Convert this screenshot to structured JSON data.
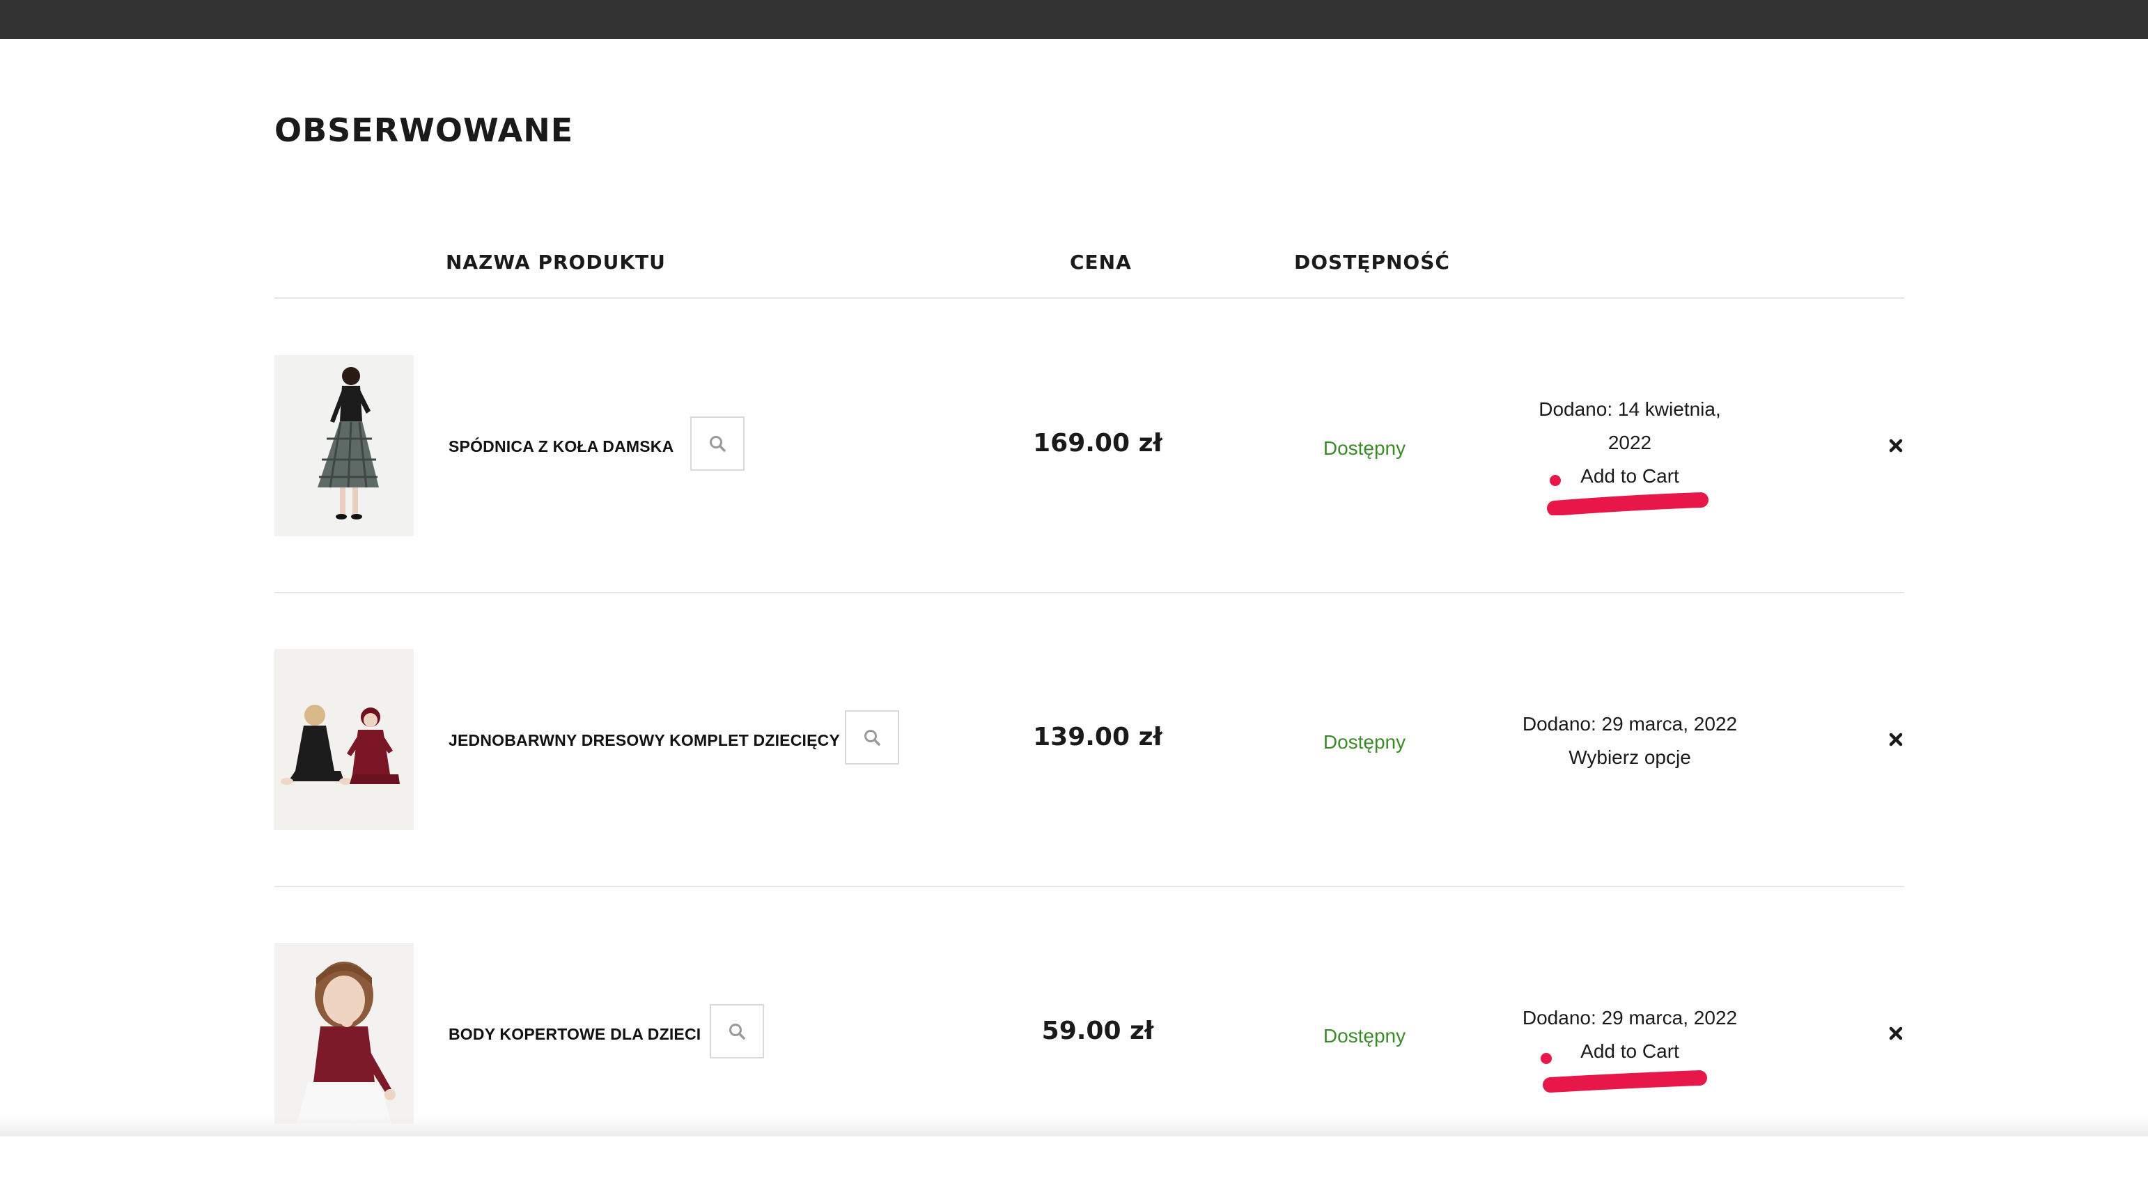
{
  "page": {
    "title": "OBSERWOWANE"
  },
  "table": {
    "headers": {
      "name": "NAZWA PRODUKTU",
      "price": "CENA",
      "availability": "DOSTĘPNOŚĆ"
    },
    "rows": [
      {
        "name": "SPÓDNICA Z KOŁA DAMSKA",
        "price": "169.00 zł",
        "availability": "Dostępny",
        "added_line1": "Dodano: 14 kwietnia,",
        "added_line2": "2022",
        "action": "Add to Cart"
      },
      {
        "name": "JEDNOBARWNY DRESOWY KOMPLET DZIECIĘCY",
        "price": "139.00 zł",
        "availability": "Dostępny",
        "added_line1": "Dodano: 29 marca, 2022",
        "action": "Wybierz opcje"
      },
      {
        "name": "BODY KOPERTOWE DLA DZIECI",
        "price": "59.00 zł",
        "availability": "Dostępny",
        "added_line1": "Dodano: 29 marca, 2022",
        "action": "Add to Cart"
      }
    ]
  },
  "icons": {
    "quick_view": "search-icon",
    "remove": "close-icon"
  },
  "colors": {
    "topbar": "#333333",
    "available": "#3b8a2a",
    "annotation": "#e8174a",
    "divider": "#e6e6e6"
  }
}
